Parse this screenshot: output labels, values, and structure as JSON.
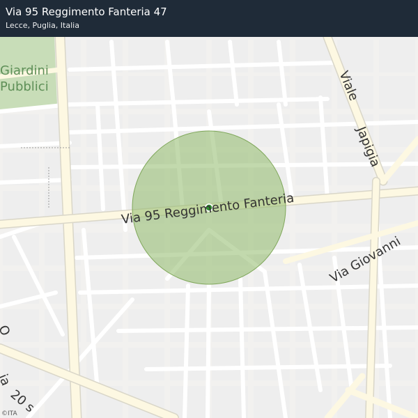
{
  "header": {
    "title": "Via 95 Reggimento Fanteria 47",
    "subtitle": "Lecce, Puglia, Italia"
  },
  "map": {
    "colors": {
      "background": "#f2f1ef",
      "block": "#eeeeee",
      "street": "#ffffff",
      "arterial": "#fdf8e2",
      "park": "#c8ddb8",
      "radius": "#8fba6a",
      "marker": "#2e8b2e"
    },
    "park_label_line1": "Giardini",
    "park_label_line2": "Pubblici",
    "street_labels": {
      "main": "Via  95  Reggimento  Fanteria",
      "viale_1": "Viale",
      "viale_2": "Japigia",
      "giovanni": "Via  Giovanni",
      "bottom_a": "O",
      "bottom_b": "ia",
      "bottom_c": "20 s"
    },
    "attribution": "©ITA"
  }
}
